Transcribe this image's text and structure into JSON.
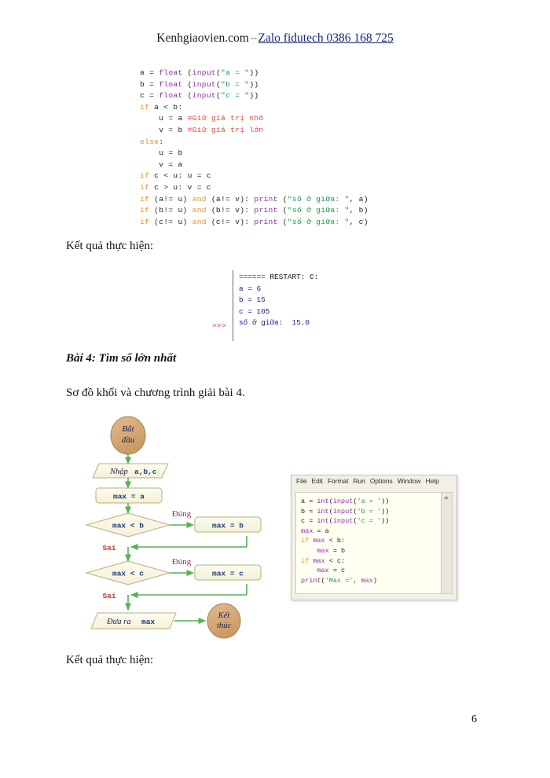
{
  "header": {
    "brand": "Kenhgiaovien.com",
    "dash": "–",
    "zalo": "Zalo fidutech 0386 168 725"
  },
  "top_code": {
    "lines": [
      [
        {
          "t": "a = ",
          "c": "plain"
        },
        {
          "t": "float",
          "c": "builtin"
        },
        {
          "t": " (",
          "c": "plain"
        },
        {
          "t": "input",
          "c": "builtin"
        },
        {
          "t": "(",
          "c": "plain"
        },
        {
          "t": "\"a = \"",
          "c": "str"
        },
        {
          "t": "))",
          "c": "plain"
        }
      ],
      [
        {
          "t": "b = ",
          "c": "plain"
        },
        {
          "t": "float",
          "c": "builtin"
        },
        {
          "t": " (",
          "c": "plain"
        },
        {
          "t": "input",
          "c": "builtin"
        },
        {
          "t": "(",
          "c": "plain"
        },
        {
          "t": "\"b = \"",
          "c": "str"
        },
        {
          "t": "))",
          "c": "plain"
        }
      ],
      [
        {
          "t": "c = ",
          "c": "plain"
        },
        {
          "t": "float",
          "c": "builtin"
        },
        {
          "t": " (",
          "c": "plain"
        },
        {
          "t": "input",
          "c": "builtin"
        },
        {
          "t": "(",
          "c": "plain"
        },
        {
          "t": "\"c = \"",
          "c": "str"
        },
        {
          "t": "))",
          "c": "plain"
        }
      ],
      [
        {
          "t": "if",
          "c": "kw"
        },
        {
          "t": " a < b:",
          "c": "plain"
        }
      ],
      [
        {
          "t": "    u = a ",
          "c": "plain"
        },
        {
          "t": "#Giữ giá trị nhỏ",
          "c": "com"
        }
      ],
      [
        {
          "t": "    v = b ",
          "c": "plain"
        },
        {
          "t": "#Giữ giá trị lớn",
          "c": "com"
        }
      ],
      [
        {
          "t": "else",
          "c": "kw"
        },
        {
          "t": ":",
          "c": "plain"
        }
      ],
      [
        {
          "t": "    u = b",
          "c": "plain"
        }
      ],
      [
        {
          "t": "    v = a",
          "c": "plain"
        }
      ],
      [
        {
          "t": "if",
          "c": "kw"
        },
        {
          "t": " c < u: u = c",
          "c": "plain"
        }
      ],
      [
        {
          "t": "if",
          "c": "kw"
        },
        {
          "t": " c > u: v = c",
          "c": "plain"
        }
      ],
      [
        {
          "t": "if",
          "c": "kw"
        },
        {
          "t": " (a!= u) ",
          "c": "plain"
        },
        {
          "t": "and",
          "c": "kw"
        },
        {
          "t": " (a!= v): ",
          "c": "plain"
        },
        {
          "t": "print",
          "c": "builtin"
        },
        {
          "t": " (",
          "c": "plain"
        },
        {
          "t": "\"số ở giữa: \"",
          "c": "str"
        },
        {
          "t": ", a)",
          "c": "plain"
        }
      ],
      [
        {
          "t": "if",
          "c": "kw"
        },
        {
          "t": " (b!= u) ",
          "c": "plain"
        },
        {
          "t": "and",
          "c": "kw"
        },
        {
          "t": " (b!= v): ",
          "c": "plain"
        },
        {
          "t": "print",
          "c": "builtin"
        },
        {
          "t": " (",
          "c": "plain"
        },
        {
          "t": "\"số ở giữa: \"",
          "c": "str"
        },
        {
          "t": ", b)",
          "c": "plain"
        }
      ],
      [
        {
          "t": "if",
          "c": "kw"
        },
        {
          "t": " (c!= u) ",
          "c": "plain"
        },
        {
          "t": "and",
          "c": "kw"
        },
        {
          "t": " (c!= v): ",
          "c": "plain"
        },
        {
          "t": "print",
          "c": "builtin"
        },
        {
          "t": " (",
          "c": "plain"
        },
        {
          "t": "\"số ở giữa: \"",
          "c": "str"
        },
        {
          "t": ", c)",
          "c": "plain"
        }
      ]
    ]
  },
  "result_label_1": "Kết quả thực hiện:",
  "shell_output": {
    "prompt": ">>>",
    "restart_line": "====== RESTART: C:",
    "lines": [
      "a = 6",
      "b = 15",
      "c = 105",
      "số ở giữa:  15.0"
    ]
  },
  "heading_bai4": "Bài 4: Tìm số lớn nhất",
  "intro_line": "Sơ đồ khối và chương trình giải bài 4.",
  "flowchart": {
    "start": "Bắt\nđầu",
    "start_line1": "Bắt",
    "start_line2": "đầu",
    "input_prefix": "Nhập",
    "input_vars": "a,b,c",
    "assign_max_a": "max = a",
    "decision_1": "max < b",
    "process_1": "max = b",
    "decision_2": "max < c",
    "process_2": "max = c",
    "output_prefix": "Đưa ra",
    "output_var": "max",
    "end_line1": "Kết",
    "end_line2": "thúc",
    "yes_label_1": "Đúng",
    "yes_label_2": "Đúng",
    "no_label_1": "Sai",
    "no_label_2": "Sai",
    "colors": {
      "terminal_fill": "#d9a97a",
      "terminal_stroke": "#9e7247",
      "box_fill": "#fbf8e4",
      "box_stroke": "#b5b07a",
      "arrow": "#56b257",
      "yes_text": "#8e2f6e",
      "no_text": "#d0342c",
      "mono_text": "#1f3d7a",
      "serif_text": "#1a1a4a"
    }
  },
  "idle_window": {
    "menu": [
      "File",
      "Edit",
      "Format",
      "Run",
      "Options",
      "Window",
      "Help"
    ],
    "code_lines": [
      [
        {
          "t": "a = ",
          "c": "plain"
        },
        {
          "t": "int",
          "c": "builtin"
        },
        {
          "t": "(",
          "c": "plain"
        },
        {
          "t": "input",
          "c": "builtin"
        },
        {
          "t": "(",
          "c": "plain"
        },
        {
          "t": "'a = '",
          "c": "str"
        },
        {
          "t": "))",
          "c": "plain"
        }
      ],
      [
        {
          "t": "b = ",
          "c": "plain"
        },
        {
          "t": "int",
          "c": "builtin"
        },
        {
          "t": "(",
          "c": "plain"
        },
        {
          "t": "input",
          "c": "builtin"
        },
        {
          "t": "(",
          "c": "plain"
        },
        {
          "t": "'b = '",
          "c": "str"
        },
        {
          "t": "))",
          "c": "plain"
        }
      ],
      [
        {
          "t": "c = ",
          "c": "plain"
        },
        {
          "t": "int",
          "c": "builtin"
        },
        {
          "t": "(",
          "c": "plain"
        },
        {
          "t": "input",
          "c": "builtin"
        },
        {
          "t": "(",
          "c": "plain"
        },
        {
          "t": "'c = '",
          "c": "str"
        },
        {
          "t": "))",
          "c": "plain"
        }
      ],
      [
        {
          "t": "max",
          "c": "builtin"
        },
        {
          "t": " = a",
          "c": "plain"
        }
      ],
      [
        {
          "t": "if",
          "c": "kw"
        },
        {
          "t": " ",
          "c": "plain"
        },
        {
          "t": "max",
          "c": "builtin"
        },
        {
          "t": " < b:",
          "c": "plain"
        }
      ],
      [
        {
          "t": "    ",
          "c": "plain"
        },
        {
          "t": "max",
          "c": "builtin"
        },
        {
          "t": " = b",
          "c": "plain"
        }
      ],
      [
        {
          "t": "if",
          "c": "kw"
        },
        {
          "t": " ",
          "c": "plain"
        },
        {
          "t": "max",
          "c": "builtin"
        },
        {
          "t": " < c:",
          "c": "plain"
        }
      ],
      [
        {
          "t": "    ",
          "c": "plain"
        },
        {
          "t": "max",
          "c": "builtin"
        },
        {
          "t": " = c",
          "c": "plain"
        }
      ],
      [
        {
          "t": "print",
          "c": "builtin"
        },
        {
          "t": "(",
          "c": "plain"
        },
        {
          "t": "'Max ='",
          "c": "str"
        },
        {
          "t": ", ",
          "c": "plain"
        },
        {
          "t": "max",
          "c": "builtin"
        },
        {
          "t": ")",
          "c": "plain"
        }
      ]
    ],
    "scrollbar_icon": "chevron-up-icon"
  },
  "result_label_2": "Kết quả thực hiện:",
  "page_number": "6"
}
